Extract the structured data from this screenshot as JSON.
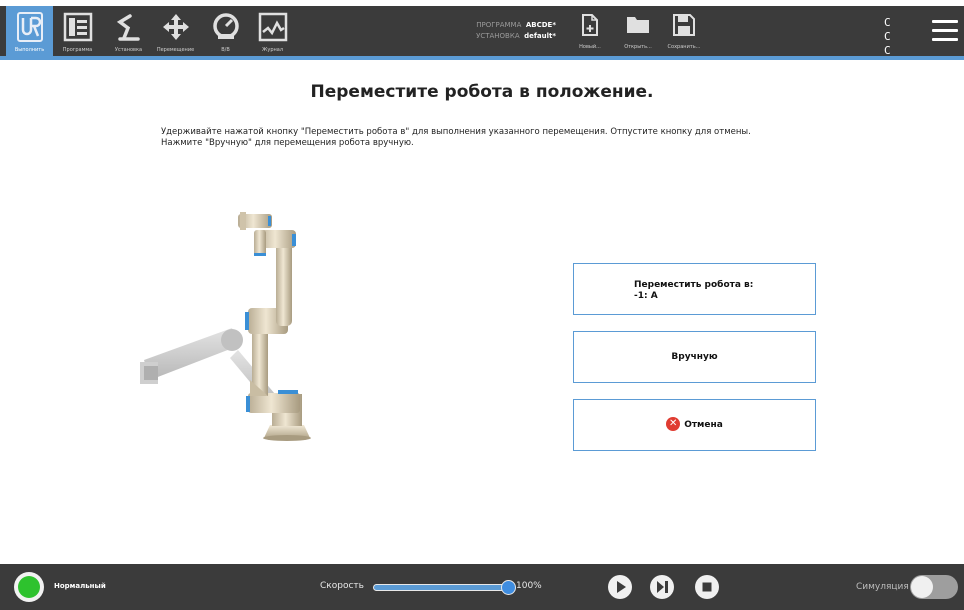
{
  "nav": {
    "tabs": [
      {
        "label": "Выполнить",
        "icon": "ur-logo-icon",
        "active": true
      },
      {
        "label": "Программа",
        "icon": "program-icon",
        "active": false
      },
      {
        "label": "Установка",
        "icon": "installation-icon",
        "active": false
      },
      {
        "label": "Перемещение",
        "icon": "move-icon",
        "active": false
      },
      {
        "label": "В/В",
        "icon": "io-icon",
        "active": false
      },
      {
        "label": "Журнал",
        "icon": "log-icon",
        "active": false
      }
    ]
  },
  "program_info": {
    "program_key": "ПРОГРАММА",
    "program_value": "ABCDE*",
    "installation_key": "УСТАНОВКА",
    "installation_value": "default*"
  },
  "file_actions": {
    "new_label": "Новый...",
    "open_label": "Открыть...",
    "save_label": "Сохранить..."
  },
  "indicator": {
    "row1": "C C",
    "row2": "C C"
  },
  "page": {
    "title": "Переместите робота в положение.",
    "instruction_line1": "Удерживайте нажатой кнопку \"Переместить робота в\" для выполнения указанного перемещения. Отпустите кнопку для отмены.",
    "instruction_line2": "Нажмите \"Вручную\" для перемещения робота вручную."
  },
  "actions": {
    "move_line1": "Переместить робота в:",
    "move_line2": "-1: A",
    "manual_label": "Вручную",
    "cancel_label": "Отмена"
  },
  "bottom": {
    "status_label": "Нормальный",
    "speed_label": "Скорость",
    "speed_value": "100%",
    "speed_fraction": 1.0,
    "simulation_label": "Симуляция",
    "simulation_on": false
  },
  "colors": {
    "accent": "#5b9bd5",
    "bar_bg": "#3b3b3b",
    "status_green": "#2ec22e",
    "cancel_red": "#e03c31"
  }
}
